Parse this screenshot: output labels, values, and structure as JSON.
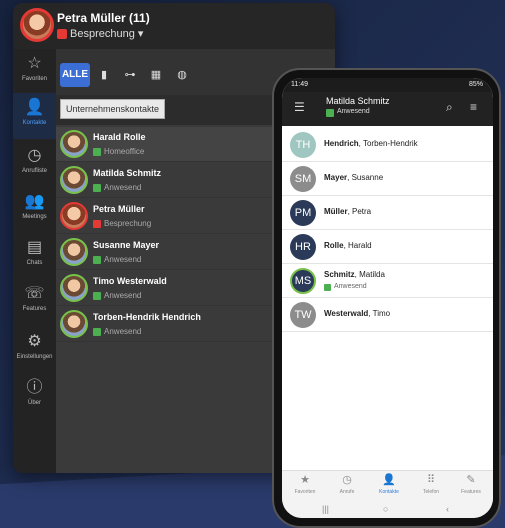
{
  "desktop": {
    "header": {
      "name": "Petra Müller (11)",
      "status": "Besprechung ▾"
    },
    "nav": [
      {
        "icon": "☆",
        "label": "Favoriten"
      },
      {
        "icon": "👤",
        "label": "Kontakte"
      },
      {
        "icon": "◷",
        "label": "Anrufliste"
      },
      {
        "icon": "👥",
        "label": "Meetings"
      },
      {
        "icon": "▤",
        "label": "Chats"
      },
      {
        "icon": "☏",
        "label": "Features"
      },
      {
        "icon": "⚙",
        "label": "Einstellungen"
      },
      {
        "icon": "ⓘ",
        "label": "Über"
      }
    ],
    "tabs": {
      "alle": "ALLE",
      "t2": "▮",
      "t3": "⊶",
      "t4": "▦",
      "t5": "◍"
    },
    "tooltip": "Unternehmenskontakte",
    "contacts": [
      {
        "name": "Harald Rolle",
        "status": "Homeoffice"
      },
      {
        "name": "Matilda Schmitz",
        "status": "Anwesend"
      },
      {
        "name": "Petra Müller",
        "status": "Besprechung"
      },
      {
        "name": "Susanne Mayer",
        "status": "Anwesend"
      },
      {
        "name": "Timo Westerwald",
        "status": "Anwesend"
      },
      {
        "name": "Torben-Hendrik Hendrich",
        "status": "Anwesend"
      }
    ]
  },
  "mobile": {
    "time": "11:49",
    "status_right": "85%",
    "title": "Matilda Schmitz",
    "status": "Anwesend",
    "contacts": [
      {
        "initials": "TH",
        "last": "Hendrich",
        "first": ", Torben-Hendrik",
        "color": "#9fc6c0"
      },
      {
        "initials": "SM",
        "last": "Mayer",
        "first": ", Susanne",
        "color": "#8c8c8c"
      },
      {
        "initials": "PM",
        "last": "Müller",
        "first": ", Petra",
        "color": "#2a3a58"
      },
      {
        "initials": "HR",
        "last": "Rolle",
        "first": ", Harald",
        "color": "#2a3a58"
      },
      {
        "initials": "MS",
        "last": "Schmitz",
        "first": ", Matilda",
        "color": "#2a3a58",
        "status": "Anwesend"
      },
      {
        "initials": "TW",
        "last": "Westerwald",
        "first": ", Timo",
        "color": "#8c8c8c"
      }
    ],
    "bottom_nav": [
      {
        "icon": "★",
        "label": "Favoriten"
      },
      {
        "icon": "◷",
        "label": "Anrufe"
      },
      {
        "icon": "👤",
        "label": "Kontakte"
      },
      {
        "icon": "⠿",
        "label": "Telefon"
      },
      {
        "icon": "✎",
        "label": "Features"
      }
    ],
    "sysnav": {
      "a": "|||",
      "b": "○",
      "c": "‹"
    }
  }
}
